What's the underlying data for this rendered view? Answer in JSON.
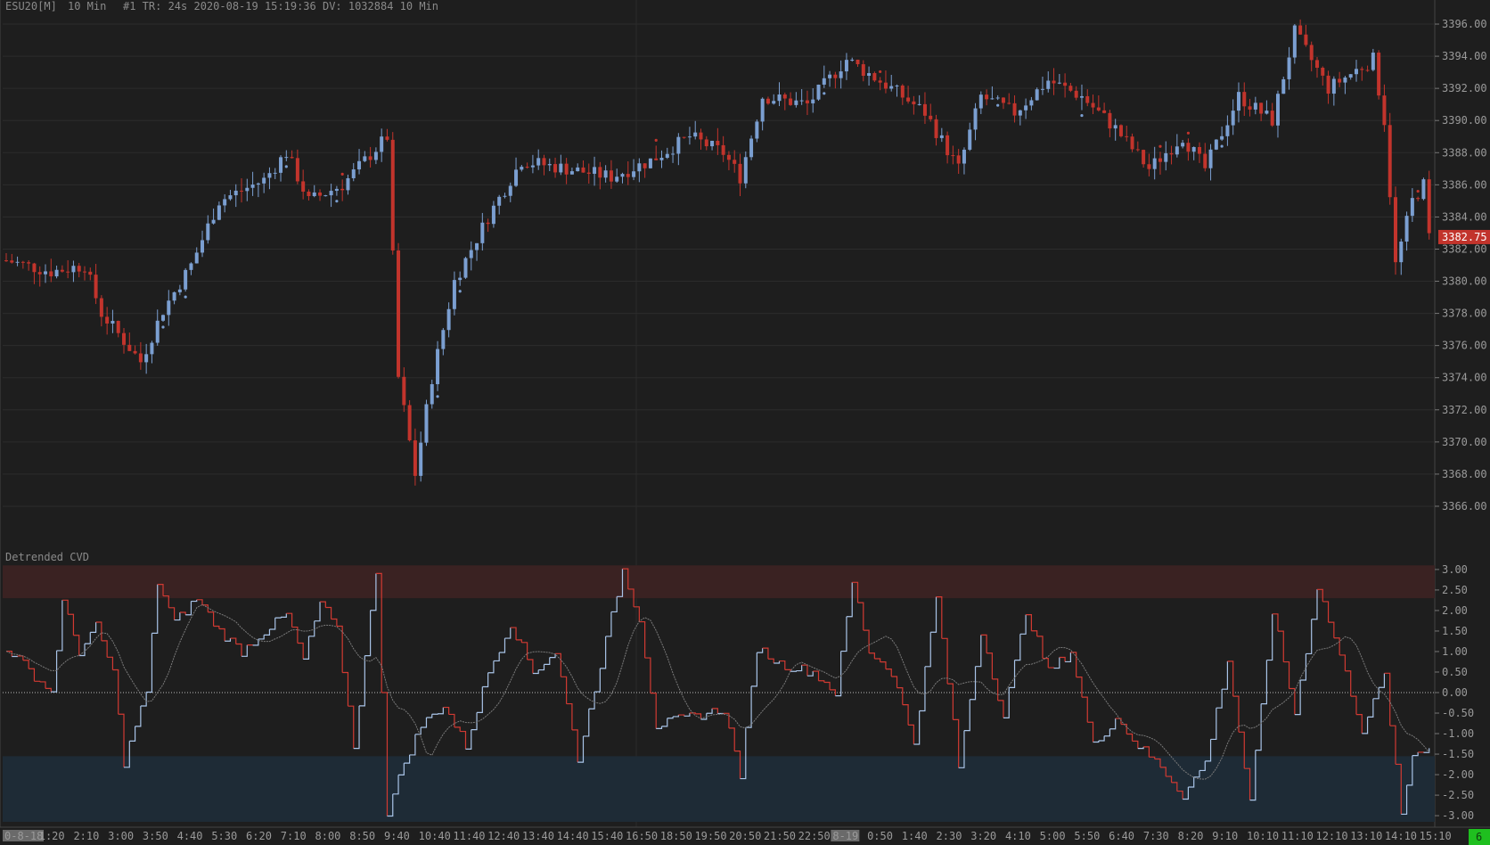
{
  "header": {
    "symbol": "ESU20[M]",
    "interval": "10 Min",
    "info": "#1 TR: 24s 2020-08-19 15:19:36 DV: 1032884 10 Min"
  },
  "colors": {
    "background": "#1e1e1e",
    "grid": "#2c2c2c",
    "bull": "#7b9fd1",
    "bear": "#c2342c",
    "price_tag_bg": "#c2342c",
    "upper_band": "#3a2222",
    "lower_band": "#1e2b36",
    "cvd_up": "#a9c4e8",
    "cvd_down": "#d13a32",
    "signal": "#7a7a7a",
    "status_ok": "#1fbf1f"
  },
  "status": {
    "badge": "6"
  },
  "chart_data": [
    {
      "type": "candlestick",
      "title": "ESU20[M] 10 Min",
      "y_ticks": [
        "3396.00",
        "3394.00",
        "3392.00",
        "3390.00",
        "3388.00",
        "3386.00",
        "3384.00",
        "3382.00",
        "3380.00",
        "3378.00",
        "3376.00",
        "3374.00",
        "3372.00",
        "3370.00",
        "3368.00",
        "3366.00"
      ],
      "ylim": [
        3365,
        3396.5
      ],
      "last_price": "3382.75",
      "close_path": [
        {
          "i": 0,
          "p": 3381.3
        },
        {
          "i": 8,
          "p": 3380.6
        },
        {
          "i": 14,
          "p": 3381.0
        },
        {
          "i": 17,
          "p": 3378.0
        },
        {
          "i": 21,
          "p": 3376.3
        },
        {
          "i": 24,
          "p": 3375.0
        },
        {
          "i": 28,
          "p": 3378.2
        },
        {
          "i": 33,
          "p": 3381.0
        },
        {
          "i": 38,
          "p": 3385.0
        },
        {
          "i": 46,
          "p": 3386.3
        },
        {
          "i": 50,
          "p": 3388.0
        },
        {
          "i": 54,
          "p": 3385.0
        },
        {
          "i": 60,
          "p": 3386.0
        },
        {
          "i": 68,
          "p": 3389.0
        },
        {
          "i": 70,
          "p": 3374.0
        },
        {
          "i": 73,
          "p": 3368.0
        },
        {
          "i": 76,
          "p": 3374.0
        },
        {
          "i": 80,
          "p": 3380.0
        },
        {
          "i": 86,
          "p": 3384.0
        },
        {
          "i": 92,
          "p": 3387.5
        },
        {
          "i": 100,
          "p": 3387.0
        },
        {
          "i": 108,
          "p": 3386.5
        },
        {
          "i": 115,
          "p": 3387.5
        },
        {
          "i": 122,
          "p": 3389.0
        },
        {
          "i": 128,
          "p": 3388.0
        },
        {
          "i": 131,
          "p": 3386.5
        },
        {
          "i": 135,
          "p": 3391.5
        },
        {
          "i": 143,
          "p": 3391.0
        },
        {
          "i": 150,
          "p": 3393.8
        },
        {
          "i": 158,
          "p": 3392.0
        },
        {
          "i": 164,
          "p": 3390.5
        },
        {
          "i": 170,
          "p": 3387.0
        },
        {
          "i": 174,
          "p": 3391.5
        },
        {
          "i": 180,
          "p": 3390.5
        },
        {
          "i": 186,
          "p": 3392.5
        },
        {
          "i": 192,
          "p": 3391.5
        },
        {
          "i": 198,
          "p": 3389.5
        },
        {
          "i": 204,
          "p": 3387.0
        },
        {
          "i": 210,
          "p": 3389.0
        },
        {
          "i": 214,
          "p": 3387.0
        },
        {
          "i": 220,
          "p": 3391.5
        },
        {
          "i": 226,
          "p": 3390.0
        },
        {
          "i": 230,
          "p": 3395.5
        },
        {
          "i": 236,
          "p": 3392.0
        },
        {
          "i": 244,
          "p": 3393.8
        },
        {
          "i": 246,
          "p": 3390.0
        },
        {
          "i": 248,
          "p": 3381.0
        },
        {
          "i": 251,
          "p": 3385.0
        },
        {
          "i": 253,
          "p": 3386.0
        },
        {
          "i": 254,
          "p": 3382.75
        }
      ],
      "bar_count": 255
    },
    {
      "type": "line",
      "title": "Detrended CVD",
      "y_ticks": [
        "3.00",
        "2.50",
        "2.00",
        "1.50",
        "1.00",
        "0.50",
        "0.00",
        "-0.50",
        "-1.00",
        "-1.50",
        "-2.00",
        "-2.50",
        "-3.00"
      ],
      "ylim": [
        -3.15,
        3.15
      ],
      "upper_band": [
        2.3,
        3.1
      ],
      "lower_band": [
        -3.15,
        -1.55
      ],
      "zero_line": 0,
      "series": [
        {
          "points": [
            {
              "i": 0,
              "v": 1.1
            },
            {
              "i": 5,
              "v": 0.4
            },
            {
              "i": 8,
              "v": 0.0
            },
            {
              "i": 10,
              "v": 2.2
            },
            {
              "i": 13,
              "v": 1.0
            },
            {
              "i": 16,
              "v": 1.6
            },
            {
              "i": 19,
              "v": 0.5
            },
            {
              "i": 21,
              "v": -1.7
            },
            {
              "i": 23,
              "v": -0.8
            },
            {
              "i": 25,
              "v": 0.0
            },
            {
              "i": 27,
              "v": 2.7
            },
            {
              "i": 30,
              "v": 1.7
            },
            {
              "i": 34,
              "v": 2.3
            },
            {
              "i": 38,
              "v": 1.5
            },
            {
              "i": 42,
              "v": 1.0
            },
            {
              "i": 46,
              "v": 1.5
            },
            {
              "i": 50,
              "v": 1.9
            },
            {
              "i": 53,
              "v": 0.8
            },
            {
              "i": 56,
              "v": 2.2
            },
            {
              "i": 59,
              "v": 1.5
            },
            {
              "i": 62,
              "v": -1.3
            },
            {
              "i": 66,
              "v": 3.0
            },
            {
              "i": 68,
              "v": -2.9
            },
            {
              "i": 71,
              "v": -1.7
            },
            {
              "i": 74,
              "v": -0.8
            },
            {
              "i": 78,
              "v": -0.3
            },
            {
              "i": 82,
              "v": -1.3
            },
            {
              "i": 86,
              "v": 0.5
            },
            {
              "i": 90,
              "v": 1.7
            },
            {
              "i": 94,
              "v": 0.5
            },
            {
              "i": 98,
              "v": 1.0
            },
            {
              "i": 102,
              "v": -1.6
            },
            {
              "i": 106,
              "v": 0.7
            },
            {
              "i": 110,
              "v": 3.0
            },
            {
              "i": 113,
              "v": 1.8
            },
            {
              "i": 116,
              "v": -0.8
            },
            {
              "i": 122,
              "v": -0.6
            },
            {
              "i": 128,
              "v": -0.4
            },
            {
              "i": 131,
              "v": -2.0
            },
            {
              "i": 134,
              "v": 1.1
            },
            {
              "i": 138,
              "v": 0.7
            },
            {
              "i": 144,
              "v": 0.5
            },
            {
              "i": 148,
              "v": 0.0
            },
            {
              "i": 151,
              "v": 2.7
            },
            {
              "i": 154,
              "v": 1.0
            },
            {
              "i": 158,
              "v": 0.5
            },
            {
              "i": 162,
              "v": -1.2
            },
            {
              "i": 166,
              "v": 2.3
            },
            {
              "i": 170,
              "v": -1.8
            },
            {
              "i": 174,
              "v": 1.5
            },
            {
              "i": 178,
              "v": -0.6
            },
            {
              "i": 182,
              "v": 2.0
            },
            {
              "i": 186,
              "v": 0.5
            },
            {
              "i": 190,
              "v": 1.0
            },
            {
              "i": 194,
              "v": -1.3
            },
            {
              "i": 198,
              "v": -0.6
            },
            {
              "i": 202,
              "v": -1.3
            },
            {
              "i": 206,
              "v": -1.8
            },
            {
              "i": 210,
              "v": -2.5
            },
            {
              "i": 214,
              "v": -1.7
            },
            {
              "i": 218,
              "v": 0.8
            },
            {
              "i": 222,
              "v": -2.7
            },
            {
              "i": 226,
              "v": 2.0
            },
            {
              "i": 230,
              "v": -0.5
            },
            {
              "i": 234,
              "v": 2.6
            },
            {
              "i": 238,
              "v": 0.9
            },
            {
              "i": 242,
              "v": -0.9
            },
            {
              "i": 246,
              "v": 0.4
            },
            {
              "i": 249,
              "v": -3.0
            },
            {
              "i": 251,
              "v": -1.5
            },
            {
              "i": 254,
              "v": -1.3
            }
          ]
        }
      ]
    }
  ],
  "time_axis": {
    "labels": [
      "0-8-18",
      "1:20",
      "2:10",
      "3:00",
      "3:50",
      "4:40",
      "5:30",
      "6:20",
      "7:10",
      "8:00",
      "8:50",
      "9:40",
      "10:40",
      "11:40",
      "12:40",
      "13:40",
      "14:40",
      "15:40",
      "16:50",
      "18:50",
      "19:50",
      "20:50",
      "21:50",
      "22:50",
      "8-19",
      "0:50",
      "1:40",
      "2:30",
      "3:20",
      "4:10",
      "5:00",
      "5:50",
      "6:40",
      "7:30",
      "8:20",
      "9:10",
      "10:10",
      "11:10",
      "12:10",
      "13:10",
      "14:10",
      "15:10"
    ],
    "highlighted": [
      "0-8-18",
      "8-19"
    ]
  }
}
